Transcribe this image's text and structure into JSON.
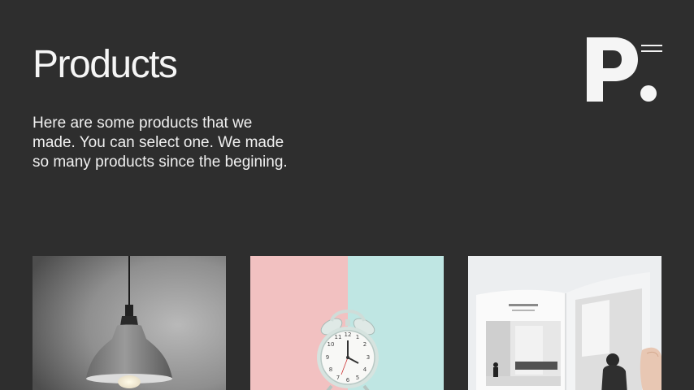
{
  "header": {
    "title": "Products",
    "intro": "Here are some products that we made. You can select one. We made so many products since the begining.",
    "logo": {
      "letter": "P",
      "icon": "brand-logo"
    },
    "menu": {
      "icon": "hamburger-menu-icon"
    }
  },
  "products": [
    {
      "name": "pendant-lamp",
      "image": "pendant-lamp-photo"
    },
    {
      "name": "alarm-clock",
      "image": "alarm-clock-photo"
    },
    {
      "name": "magazine",
      "image": "open-magazine-photo"
    }
  ],
  "colors": {
    "background": "#2e2e2e",
    "text": "#f2f2f2",
    "clock_left_bg": "#f2c1c1",
    "clock_right_bg": "#bfe6e3"
  }
}
